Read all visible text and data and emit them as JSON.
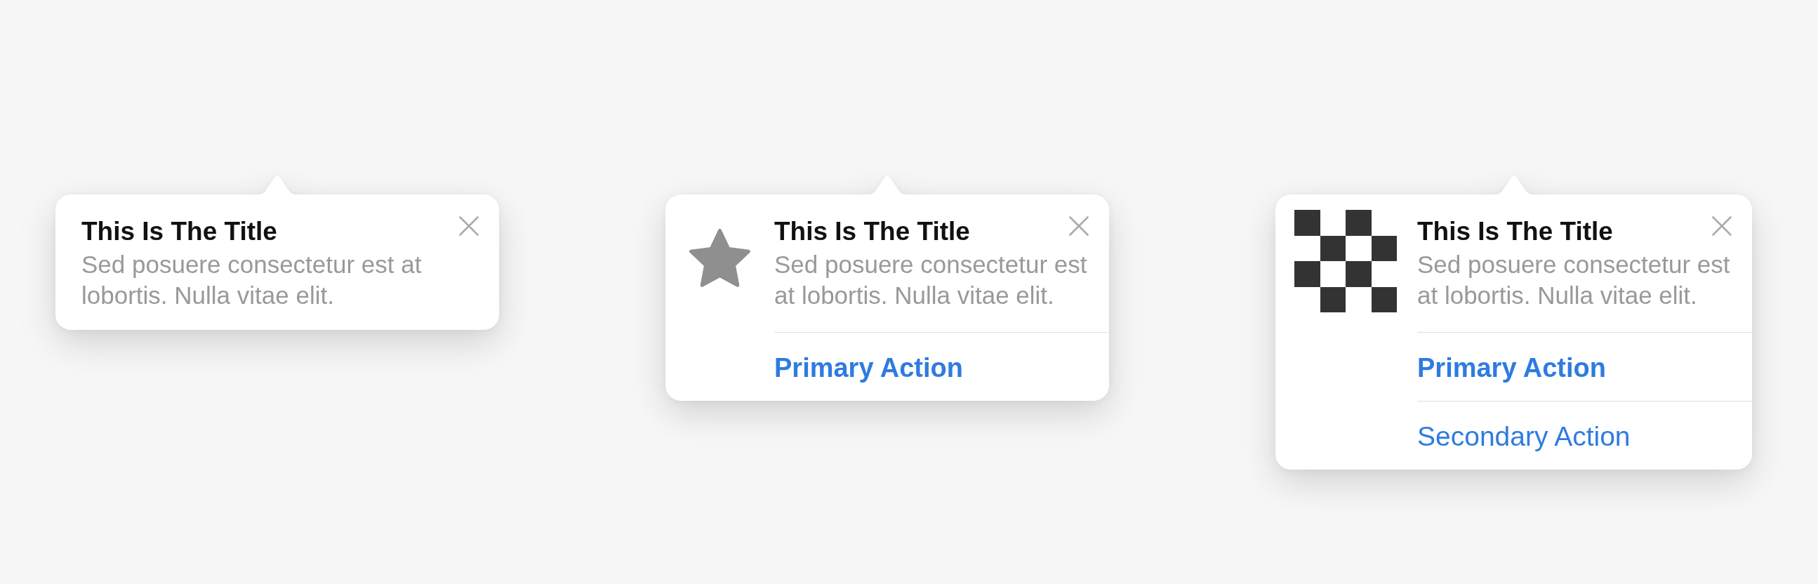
{
  "popovers": [
    {
      "title": "This Is The Title",
      "message": "Sed posuere consectetur est at lobortis. Nulla vitae elit.",
      "dismissible": true
    },
    {
      "media": {
        "kind": "star"
      },
      "title": "This Is The Title",
      "message": "Sed posuere consectetur est at lobortis. Nulla vitae elit.",
      "dismissible": true,
      "actions": [
        {
          "label": "Primary Action",
          "kind": "primary"
        }
      ]
    },
    {
      "media": {
        "kind": "checkerboard"
      },
      "title": "This Is The Title",
      "message": "Sed posuere consectetur est at lobortis. Nulla vitae elit.",
      "dismissible": true,
      "actions": [
        {
          "label": "Primary Action",
          "kind": "primary"
        },
        {
          "label": "Secondary Action",
          "kind": "secondary"
        }
      ]
    }
  ]
}
